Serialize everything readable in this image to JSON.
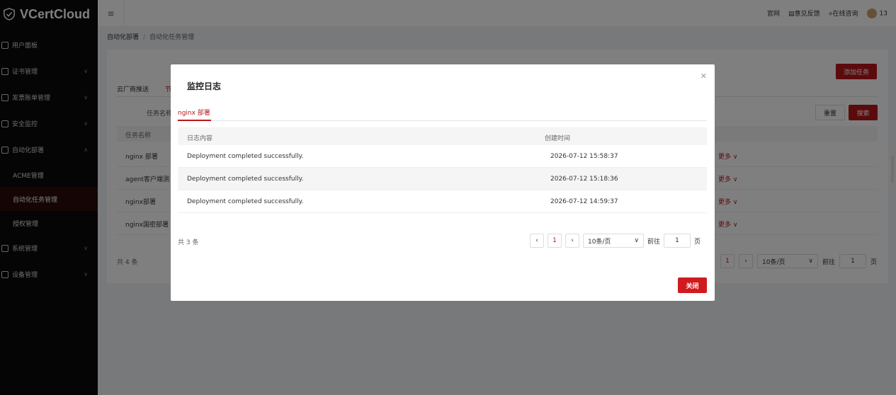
{
  "brand": {
    "name": "VCertCloud"
  },
  "header": {
    "links": [
      "官网",
      "意见反馈",
      "在线咨询"
    ],
    "user": "13"
  },
  "sidebar": {
    "items": [
      {
        "label": "用户面板",
        "icon": "dashboard-icon"
      },
      {
        "label": "证书管理",
        "icon": "certificate-icon"
      },
      {
        "label": "发票账单管理",
        "icon": "invoice-icon"
      },
      {
        "label": "安全监控",
        "icon": "monitor-icon"
      },
      {
        "label": "自动化部署",
        "icon": "deploy-icon"
      },
      {
        "label": "ACME管理"
      },
      {
        "label": "自动化任务管理"
      },
      {
        "label": "授权管理"
      },
      {
        "label": "系统管理",
        "icon": "system-icon"
      },
      {
        "label": "设备管理",
        "icon": "device-icon"
      }
    ]
  },
  "breadcrumb": {
    "first": "自动化部署",
    "sep": "/",
    "current": "自动化任务管理"
  },
  "page": {
    "add_button": "添加任务",
    "tabs": [
      "云厂商推送",
      "节"
    ],
    "filter_label": "任务名称",
    "reset": "重置",
    "search": "搜索",
    "table_header": "任务名称",
    "rows": [
      "nginx 部署",
      "agent客户端测",
      "nginx部署",
      "nginx国密部署"
    ],
    "more": "更多",
    "total": "共 4 条",
    "pager": {
      "page": "1",
      "size": "10条/页",
      "goto": "前往",
      "goto_value": "1",
      "page_unit": "页"
    }
  },
  "modal": {
    "title": "监控日志",
    "tab": "nginx 部署",
    "columns": [
      "日志内容",
      "创建时间"
    ],
    "rows": [
      {
        "content": "Deployment completed successfully.",
        "time": "2026-07-12 15:58:37"
      },
      {
        "content": "Deployment completed successfully.",
        "time": "2026-07-12 15:18:36"
      },
      {
        "content": "Deployment completed successfully.",
        "time": "2026-07-12 14:59:37"
      }
    ],
    "total": "共 3 条",
    "pager": {
      "page": "1",
      "size": "10条/页",
      "goto": "前往",
      "goto_value": "1",
      "page_unit": "页"
    },
    "close_button": "关闭"
  },
  "colors": {
    "accent": "#b8171a",
    "sidebar_bg": "#0b0b0b"
  }
}
